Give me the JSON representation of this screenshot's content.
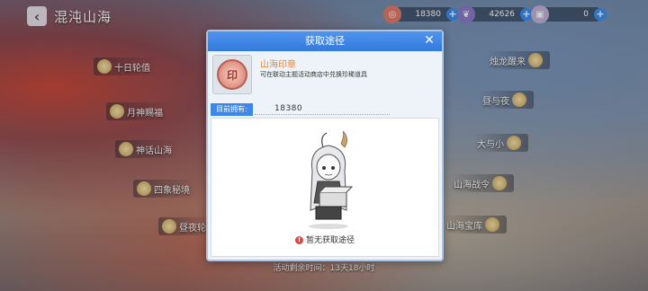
{
  "header": {
    "title": "混沌山海"
  },
  "currencies": [
    {
      "icon": "seal-coin-icon",
      "value": "18380",
      "color": "#e07a6a"
    },
    {
      "icon": "feather-icon",
      "value": "42626",
      "color": "#8a7ac8"
    },
    {
      "icon": "ticket-icon",
      "value": "0",
      "color": "#c0b0d8"
    }
  ],
  "menu": {
    "left": [
      "十日轮值",
      "月神赐福",
      "神话山海",
      "四象秘境",
      "昼夜轮"
    ],
    "right": [
      "烛龙醒来",
      "昼与夜",
      "大与小",
      "山海战令",
      "山海宝库"
    ]
  },
  "timer": {
    "text": "活动剩余时间：13天18小时"
  },
  "modal": {
    "title": "获取途径",
    "item_name": "山海印章",
    "item_desc": "可在联动主题活动商店中兑换珍稀道具",
    "seal_glyph": "印",
    "owned_label": "目前拥有:",
    "owned_value": "18380",
    "empty_text": "暂无获取途径",
    "warn_glyph": "!",
    "close_glyph": "✕"
  },
  "colors": {
    "header_blue": "#3b82e6",
    "item_name_orange": "#e98534",
    "warn_red": "#e0463a"
  }
}
